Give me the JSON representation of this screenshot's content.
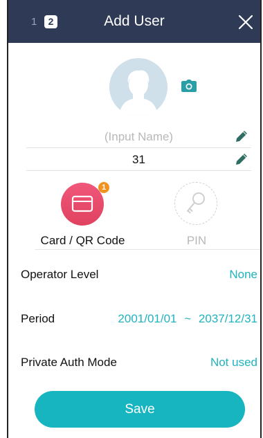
{
  "header": {
    "step_1": "1",
    "step_2": "2",
    "title": "Add User",
    "close_icon": "close-icon"
  },
  "profile": {
    "avatar_icon": "user-avatar-icon",
    "camera_icon": "camera-icon",
    "name_placeholder": "(Input Name)",
    "user_id": "31",
    "edit_icon": "pencil-icon"
  },
  "auth": {
    "card": {
      "label": "Card / QR Code",
      "badge_count": "1",
      "icon": "card-icon",
      "color": "#e8496a"
    },
    "pin": {
      "label": "PIN",
      "icon": "key-icon"
    }
  },
  "settings": {
    "operator_level": {
      "label": "Operator Level",
      "value": "None"
    },
    "period": {
      "label": "Period",
      "start": "2001/01/01",
      "separator": "~",
      "end": "2037/12/31"
    },
    "private_auth_mode": {
      "label": "Private Auth Mode",
      "value": "Not used"
    }
  },
  "actions": {
    "save_label": "Save"
  },
  "colors": {
    "header_bg": "#2f3a56",
    "accent": "#1fb3bd",
    "save_bg": "#16b5c0",
    "badge": "#f29320"
  }
}
